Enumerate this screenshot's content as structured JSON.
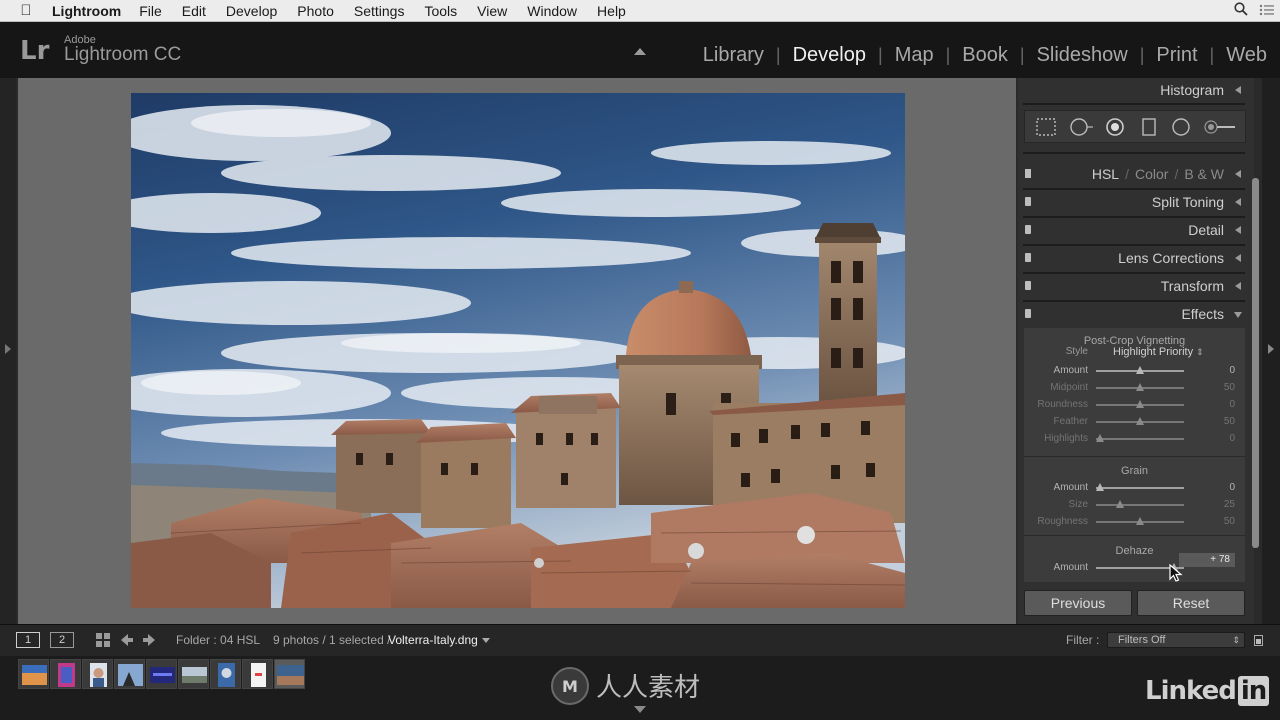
{
  "menubar": {
    "apple_icon": "apple-icon",
    "app_name": "Lightroom",
    "items": [
      "File",
      "Edit",
      "Develop",
      "Photo",
      "Settings",
      "Tools",
      "View",
      "Window",
      "Help"
    ],
    "search_icon": "search-icon",
    "list_icon": "notification-list-icon"
  },
  "identity": {
    "badge": "Lr",
    "adobe": "Adobe",
    "product": "Lightroom CC"
  },
  "modules": [
    "Library",
    "Develop",
    "Map",
    "Book",
    "Slideshow",
    "Print",
    "Web"
  ],
  "active_module": "Develop",
  "right_panel": {
    "histogram_label": "Histogram",
    "tools": [
      "crop-overlay-icon",
      "spot-removal-icon",
      "red-eye-icon",
      "graduated-filter-icon",
      "radial-filter-icon",
      "adjustment-brush-icon"
    ],
    "hsl": {
      "hsl": "HSL",
      "sep": "/",
      "color": "Color",
      "bw": "B & W"
    },
    "panels": [
      "Split Toning",
      "Detail",
      "Lens Corrections",
      "Transform",
      "Effects"
    ],
    "effects": {
      "vignette_title": "Post-Crop Vignetting",
      "style_label": "Style",
      "style_value": "Highlight Priority",
      "vignette_rows": [
        {
          "label": "Amount",
          "value": "0",
          "position": 0.5,
          "enabled": true
        },
        {
          "label": "Midpoint",
          "value": "50",
          "position": 0.5,
          "enabled": false
        },
        {
          "label": "Roundness",
          "value": "0",
          "position": 0.5,
          "enabled": false
        },
        {
          "label": "Feather",
          "value": "50",
          "position": 0.5,
          "enabled": false
        },
        {
          "label": "Highlights",
          "value": "0",
          "position": 0.05,
          "enabled": false
        }
      ],
      "grain_title": "Grain",
      "grain_rows": [
        {
          "label": "Amount",
          "value": "0",
          "position": 0.05,
          "enabled": true
        },
        {
          "label": "Size",
          "value": "25",
          "position": 0.27,
          "enabled": false
        },
        {
          "label": "Roughness",
          "value": "50",
          "position": 0.5,
          "enabled": false
        }
      ],
      "dehaze_title": "Dehaze",
      "dehaze_label": "Amount",
      "dehaze_value": "+ 78",
      "dehaze_position": 0.89
    },
    "previous_label": "Previous",
    "reset_label": "Reset"
  },
  "filmbar": {
    "page1": "1",
    "page2": "2",
    "folder": "Folder : 04 HSL",
    "photos": "9 photos / 1 selected /",
    "filename": "Volterra-Italy.dng",
    "filter_label": "Filter :",
    "filter_value": "Filters Off"
  },
  "filmstrip": {
    "thumb_count": 9,
    "selected_index": 8
  },
  "watermark": {
    "logo_text": "人人素材",
    "linkedin": "Linked",
    "linkedin_in": "in"
  },
  "colors": {
    "active_module": "#f0f0f0",
    "inactive_module": "#a9a9a9",
    "panel_bg": "#303030",
    "canvas_bg": "#6a6a6a"
  }
}
